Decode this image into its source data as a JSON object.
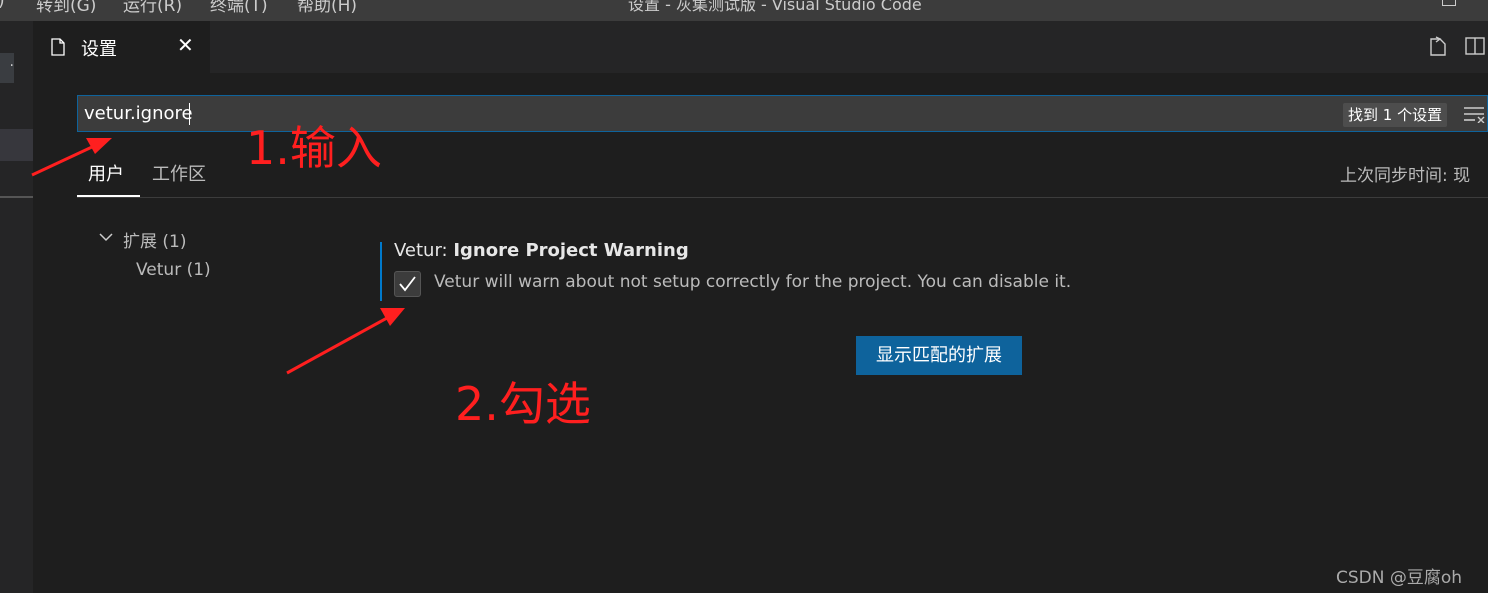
{
  "titlebar": {
    "menus": [
      ")",
      "转到(G)",
      "运行(R)",
      "终端(T)",
      "帮助(H)"
    ],
    "window_title": "设置 - 灰集测试版 - Visual Studio Code"
  },
  "leftstrip": {
    "button_glyph": "·"
  },
  "tab": {
    "label": "设置",
    "close": "✕"
  },
  "search": {
    "value": "vetur.ignore",
    "found": "找到 1 个设置"
  },
  "scope": {
    "user": "用户",
    "workspace": "工作区",
    "sync": "上次同步时间: 现"
  },
  "tree": {
    "extensions": "扩展 (1)",
    "vetur": "Vetur (1)"
  },
  "setting": {
    "category": "Vetur: ",
    "name": "Ignore Project Warning",
    "description": "Vetur will warn about not setup correctly for the project. You can disable it.",
    "checked": true
  },
  "show_extensions_button": "显示匹配的扩展",
  "annotations": {
    "step1": "1.输入",
    "step2": "2.勾选"
  },
  "watermark": "CSDN @豆腐oh",
  "colors": {
    "accent": "#007acc",
    "button": "#0e639c",
    "annotation": "#ff1f1f",
    "background": "#1e1e1e"
  }
}
